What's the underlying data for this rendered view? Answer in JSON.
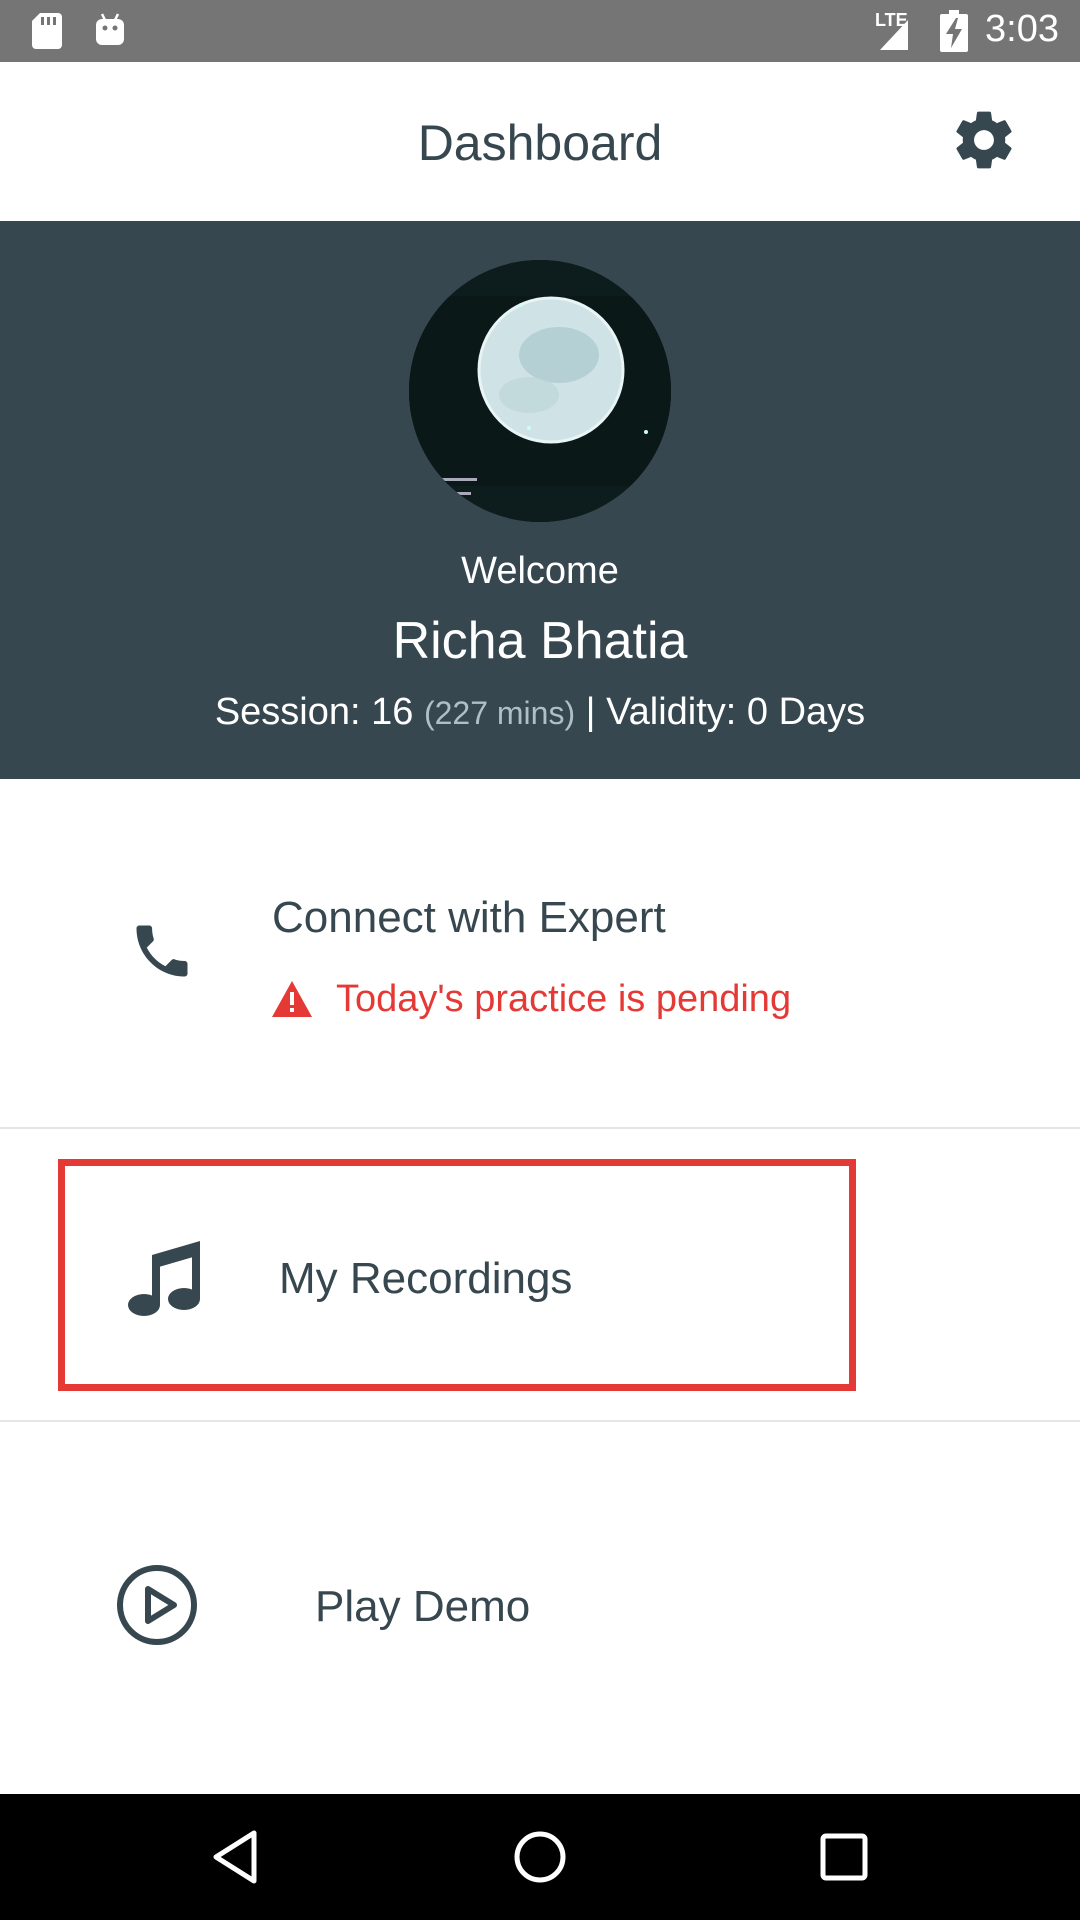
{
  "status_bar": {
    "network_type": "LTE",
    "time": "3:03"
  },
  "header": {
    "title": "Dashboard"
  },
  "profile": {
    "welcome": "Welcome",
    "name": "Richa Bhatia",
    "session_label": "Session: 16",
    "session_mins": "(227 mins)",
    "validity_text": "| Validity: 0 Days"
  },
  "menu": {
    "connect": {
      "label": "Connect with Expert",
      "warning": "Today's practice is pending",
      "icon": "phone-icon"
    },
    "recordings": {
      "label": "My Recordings",
      "icon": "music-note-icon"
    },
    "demo": {
      "label": "Play Demo",
      "icon": "play-circle-icon"
    }
  },
  "colors": {
    "header_band": "#37474f",
    "warning": "#e53935",
    "highlight_border": "#e53935",
    "text_primary": "#37474f"
  }
}
